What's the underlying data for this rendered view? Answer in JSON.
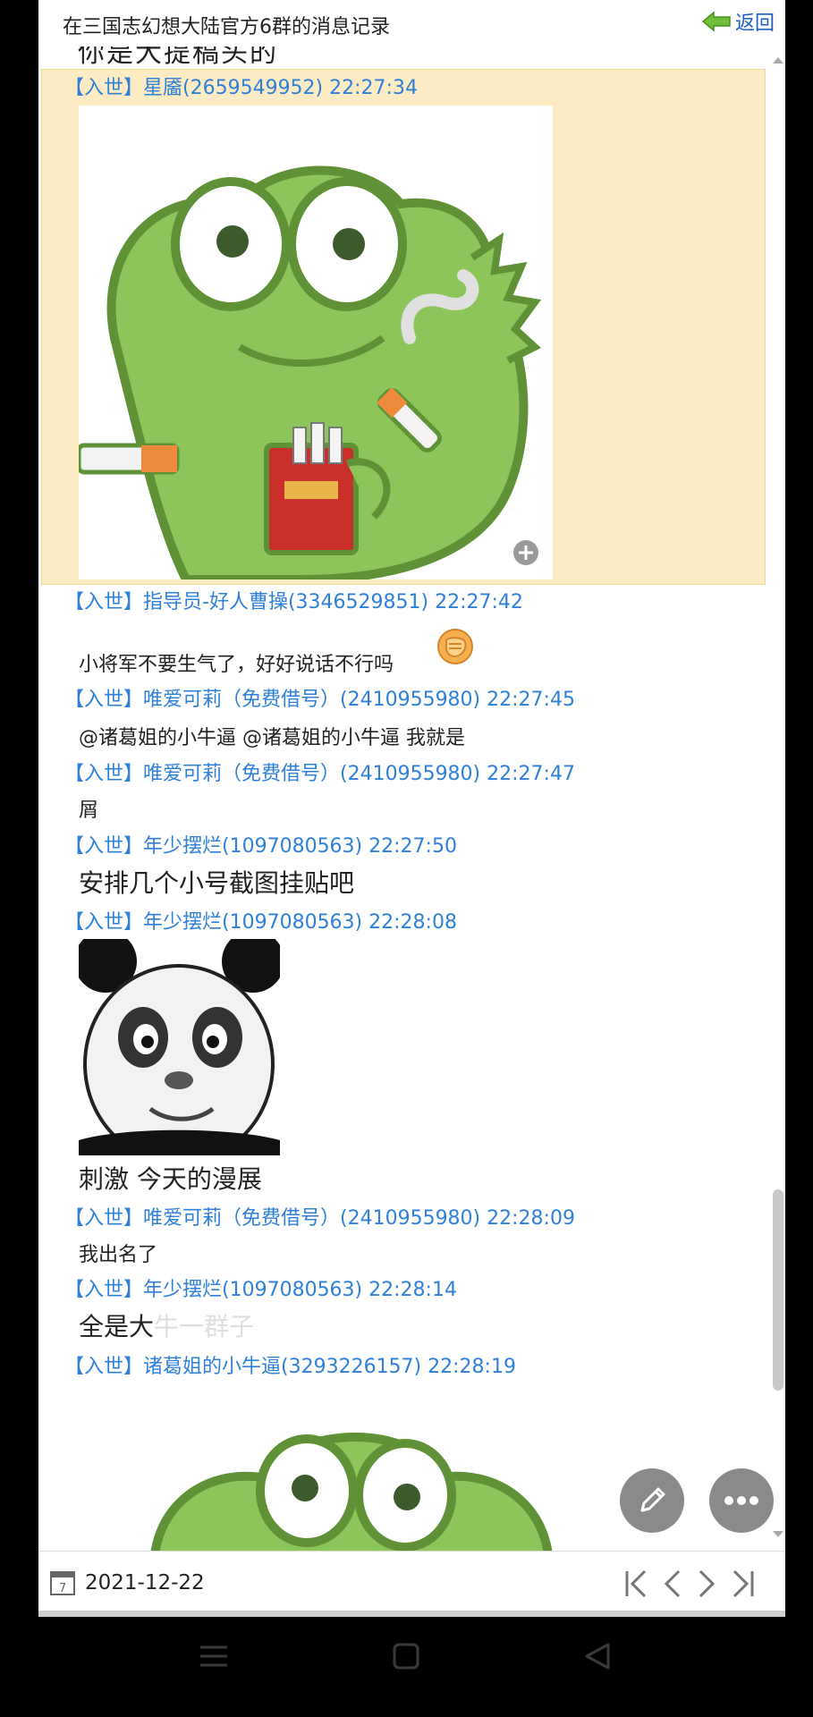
{
  "window": {
    "title": "在三国志幻想大陆官方6群的消息记录",
    "back_label": "返回"
  },
  "chat": {
    "cut_text": "你是大提稿头的",
    "messages": [
      {
        "header": "【入世】星靥(2659549952) 22:27:34",
        "content_type": "image",
        "image": "green-dinosaur-smoking-sticker"
      },
      {
        "header": "【入世】指导员-好人曹操(3346529851) 22:27:42",
        "content_type": "text",
        "text": "小将军不要生气了，好好说话不行吗",
        "emoji": "fist-emoji"
      },
      {
        "header": "【入世】唯爱可莉（免费借号）(2410955980) 22:27:45",
        "content_type": "text",
        "text": "@诸葛姐的小牛逼 @诸葛姐的小牛逼 我就是"
      },
      {
        "header": "【入世】唯爱可莉（免费借号）(2410955980) 22:27:47",
        "content_type": "text",
        "text": "屑"
      },
      {
        "header": "【入世】年少摆烂(1097080563) 22:27:50",
        "content_type": "text",
        "text": "安排几个小号截图挂贴吧"
      },
      {
        "header": "【入世】年少摆烂(1097080563) 22:28:08",
        "content_type": "image+text",
        "image": "panda-face-meme",
        "text": "刺激 今天的漫展"
      },
      {
        "header": "【入世】唯爱可莉（免费借号）(2410955980) 22:28:09",
        "content_type": "text",
        "text": "我出名了"
      },
      {
        "header": "【入世】年少摆烂(1097080563) 22:28:14",
        "content_type": "text",
        "text": "全是大牛一群子"
      },
      {
        "header": "【入世】诸葛姐的小牛逼(3293226157) 22:28:19",
        "content_type": "image",
        "image": "green-dinosaur-sticker"
      }
    ]
  },
  "footer": {
    "date": "2021-12-22",
    "calendar_day": "7"
  },
  "colors": {
    "header_blue": "#2f80d9",
    "highlight": "#fcebc3",
    "dino_green": "#8cc65a",
    "dino_outline": "#5f9236"
  }
}
